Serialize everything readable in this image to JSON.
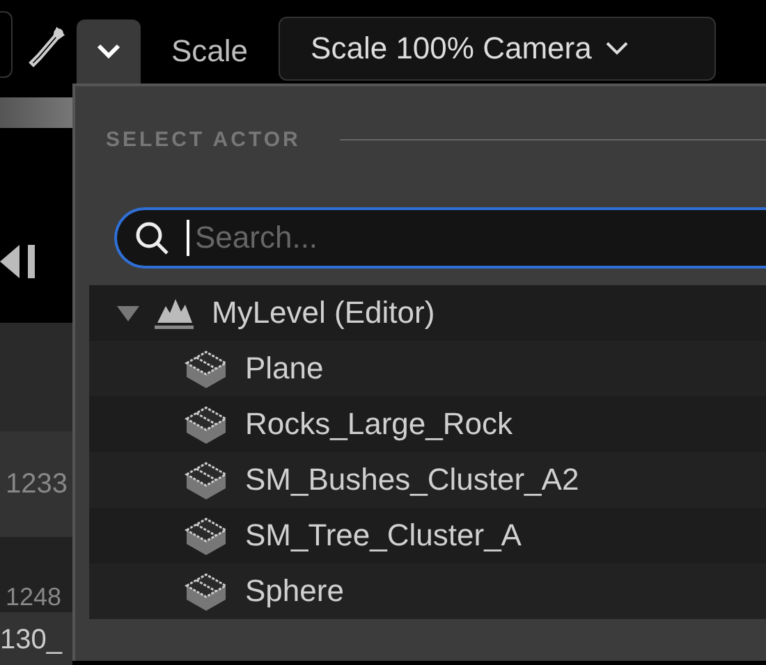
{
  "toolbar": {
    "scale_label": "Scale",
    "scale_dropdown": "Scale 100% Camera"
  },
  "background_column": {
    "values": [
      "1233",
      "1248",
      "130_"
    ]
  },
  "popup": {
    "header": "SELECT ACTOR",
    "search": {
      "placeholder": "Search..."
    },
    "tree": [
      {
        "label": "MyLevel (Editor)",
        "kind": "level",
        "expanded": true,
        "children": [
          {
            "label": "Plane",
            "kind": "mesh"
          },
          {
            "label": "Rocks_Large_Rock",
            "kind": "mesh"
          },
          {
            "label": "SM_Bushes_Cluster_A2",
            "kind": "mesh"
          },
          {
            "label": "SM_Tree_Cluster_A",
            "kind": "mesh"
          },
          {
            "label": "Sphere",
            "kind": "mesh"
          }
        ]
      }
    ]
  }
}
